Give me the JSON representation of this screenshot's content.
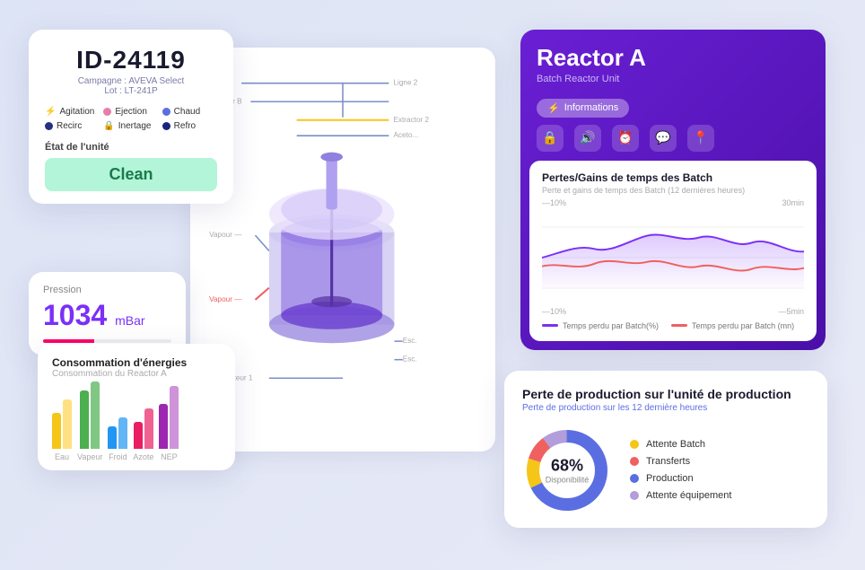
{
  "id_card": {
    "title": "ID-24119",
    "campaign_label": "Campagne : AVEVA Select",
    "lot_label": "Lot : LT-241P",
    "status_items": [
      {
        "icon": "⚡",
        "label": "Agitation",
        "dot": "yellow"
      },
      {
        "icon": "",
        "label": "Ejection",
        "dot": "pink"
      },
      {
        "icon": "",
        "label": "Chaud",
        "dot": "blue"
      },
      {
        "icon": "",
        "label": "Recirc",
        "dot": "navy"
      },
      {
        "icon": "🔒",
        "label": "Inertage",
        "dot": "orange"
      },
      {
        "icon": "",
        "label": "Refro",
        "dot": "darkblue"
      }
    ],
    "etat_label": "État de l'unité",
    "clean_btn": "Clean"
  },
  "pressure_card": {
    "label": "Pression",
    "value": "1034",
    "unit": "mBar"
  },
  "energy_card": {
    "title": "Consommation d'énergies",
    "subtitle": "Consommation du Reactor A",
    "bars": [
      {
        "label": "Eau",
        "colors": [
          "#f5c518",
          "#f5c518"
        ],
        "heights": [
          40,
          55
        ]
      },
      {
        "label": "Vapeur",
        "colors": [
          "#4caf50",
          "#4caf50"
        ],
        "heights": [
          65,
          75
        ]
      },
      {
        "label": "Froid",
        "colors": [
          "#2196f3",
          "#2196f3"
        ],
        "heights": [
          25,
          35
        ]
      },
      {
        "label": "Azote",
        "colors": [
          "#e91e63",
          "#e91e63"
        ],
        "heights": [
          30,
          45
        ]
      },
      {
        "label": "NEP",
        "colors": [
          "#9c27b0",
          "#9c27b0"
        ],
        "heights": [
          50,
          70
        ]
      }
    ]
  },
  "reactor_card": {
    "title": "Reactor A",
    "subtitle": "Batch Reactor Unit",
    "tab_info": "Informations",
    "icons": [
      "⚡",
      "🔒",
      "🔊",
      "⏰",
      "💬",
      "📍"
    ],
    "chart_title": "Pertes/Gains de temps des Batch",
    "chart_subtitle": "Perte et gains de temps des Batch (12 dernières heures)",
    "axis_left_top": "—10%",
    "axis_right_top": "30min",
    "axis_left_bottom": "—10%",
    "axis_right_bottom": "—5min",
    "legend_items": [
      {
        "label": "Temps perdu par Batch(%)",
        "color": "#7b2ff7"
      },
      {
        "label": "Temps perdu par Batch (mn)",
        "color": "#f06060"
      }
    ]
  },
  "production_card": {
    "title": "Perte de production sur l'unité de production",
    "subtitle": "Perte de production sur les 12 dernière heures",
    "donut_pct": "68%",
    "donut_label": "Disponibilité",
    "legend_items": [
      {
        "label": "Attente Batch",
        "color": "#f5c518"
      },
      {
        "label": "Transferts",
        "color": "#f06060"
      },
      {
        "label": "Production",
        "color": "#5b6ee1"
      },
      {
        "label": "Attente équipement",
        "color": "#b39ddb"
      }
    ],
    "donut_segments": [
      {
        "pct": 68,
        "color": "#5b6ee1"
      },
      {
        "pct": 12,
        "color": "#f5c518"
      },
      {
        "pct": 10,
        "color": "#f06060"
      },
      {
        "pct": 10,
        "color": "#b39ddb"
      }
    ]
  }
}
